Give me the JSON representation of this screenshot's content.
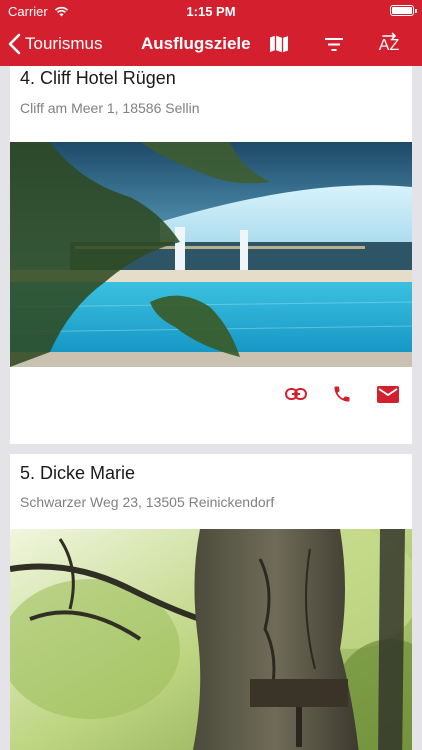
{
  "status_bar": {
    "carrier": "Carrier",
    "time": "1:15 PM"
  },
  "nav": {
    "back_label": "Tourismus",
    "title": "Ausflugsziele",
    "sort_label": "AZ",
    "icons": [
      "chevron-left-icon",
      "map-icon",
      "filter-icon",
      "sort-az-icon"
    ]
  },
  "colors": {
    "accent": "#d4202e",
    "background": "#e4e4e8",
    "card": "#ffffff",
    "address": "#808080"
  },
  "places": [
    {
      "title": "4. Cliff Hotel Rügen",
      "address": "Cliff am Meer 1, 18586 Sellin",
      "image": "indoor swimming pool",
      "actions": [
        "link-icon",
        "phone-icon",
        "mail-icon"
      ]
    },
    {
      "title": "5. Dicke Marie",
      "address": "Schwarzer Weg 23, 13505 Reinickendorf",
      "image": "old oak tree trunk"
    }
  ]
}
